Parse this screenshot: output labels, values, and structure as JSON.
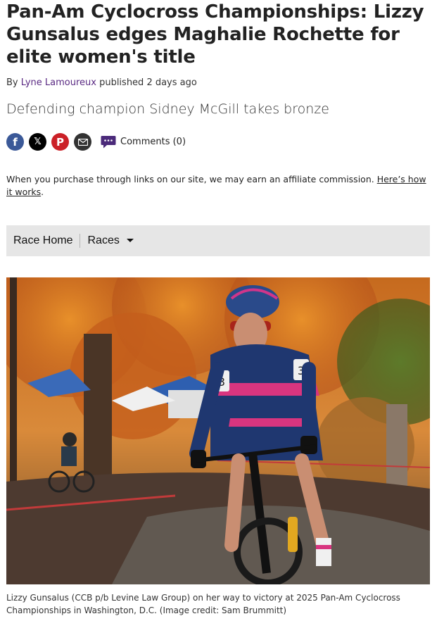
{
  "article": {
    "title": "Pan-Am Cyclocross Championships: Lizzy Gunsalus edges Maghalie Rochette for elite women's title",
    "byline_prefix": "By",
    "author": "Lyne Lamoureux",
    "published": "published 2 days ago",
    "subtitle": "Defending champion Sidney McGill takes bronze"
  },
  "share": {
    "facebook_icon": "f",
    "x_icon": "𝕏",
    "pinterest_icon": "P",
    "comments_label": "Comments (0)"
  },
  "affiliate": {
    "text": "When you purchase through links on our site, we may earn an affiliate commission. ",
    "link": "Here’s how it works",
    "end": "."
  },
  "race_nav": {
    "home": "Race Home",
    "races": "Races"
  },
  "photo": {
    "caption": "Lizzy Gunsalus (CCB p/b Levine Law Group) on her way to victory at 2025 Pan-Am Cyclocross Championships in Washington, D.C. (Image credit: Sam Brummitt)",
    "bib_number": "3"
  },
  "colors": {
    "facebook": "#3b5998",
    "pinterest": "#cb2027",
    "author_link": "#5a2a83",
    "nav_bg": "#e6e6e6"
  }
}
